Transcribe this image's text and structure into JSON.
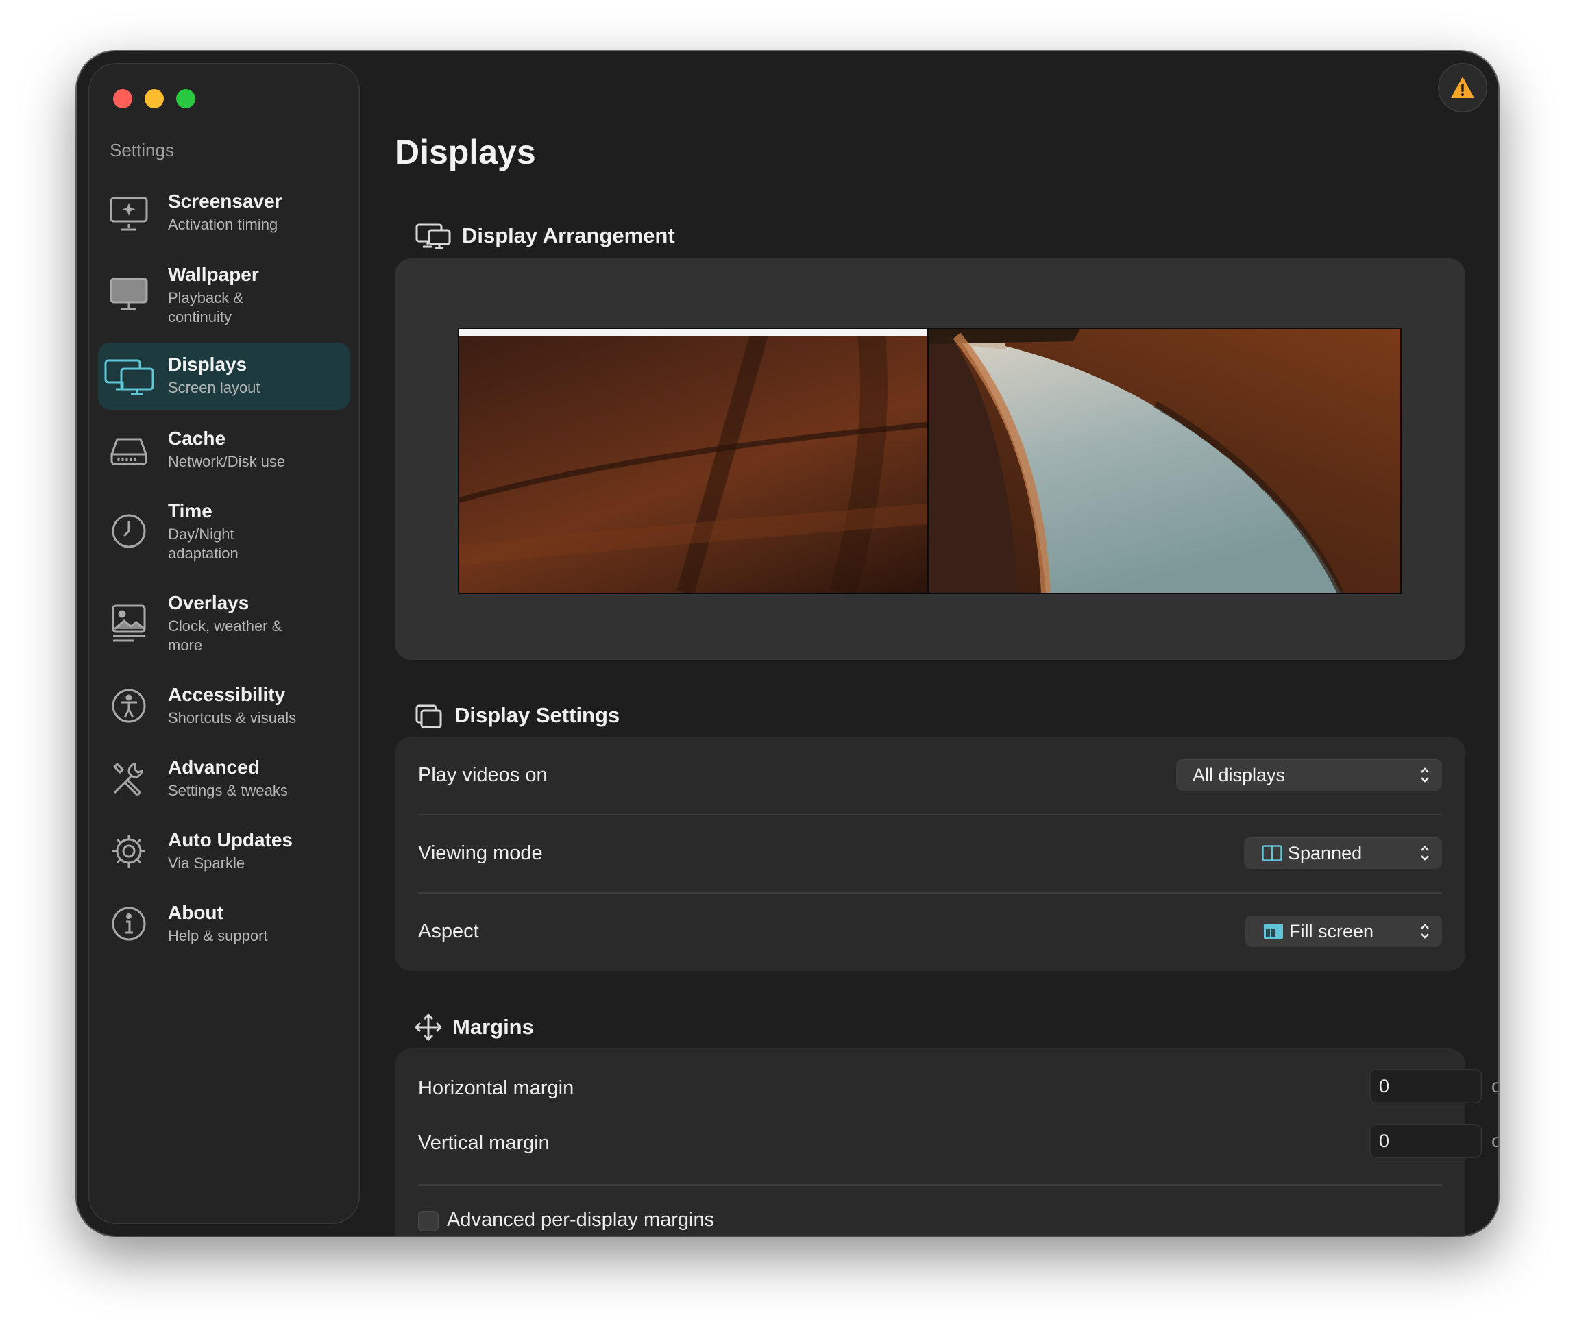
{
  "sidebar": {
    "heading": "Settings",
    "items": [
      {
        "title": "Screensaver",
        "subtitle": "Activation timing",
        "icon": "screensaver-icon"
      },
      {
        "title": "Wallpaper",
        "subtitle": "Playback & continuity",
        "icon": "monitor-icon"
      },
      {
        "title": "Displays",
        "subtitle": "Screen layout",
        "icon": "displays-icon",
        "active": true
      },
      {
        "title": "Cache",
        "subtitle": "Network/Disk use",
        "icon": "disk-icon"
      },
      {
        "title": "Time",
        "subtitle": "Day/Night adaptation",
        "icon": "clock-icon"
      },
      {
        "title": "Overlays",
        "subtitle": "Clock, weather & more",
        "icon": "photo-icon"
      },
      {
        "title": "Accessibility",
        "subtitle": "Shortcuts & visuals",
        "icon": "accessibility-icon"
      },
      {
        "title": "Advanced",
        "subtitle": "Settings & tweaks",
        "icon": "tools-icon"
      },
      {
        "title": "Auto Updates",
        "subtitle": "Via Sparkle",
        "icon": "gear-icon"
      },
      {
        "title": "About",
        "subtitle": "Help & support",
        "icon": "info-icon"
      }
    ]
  },
  "header": {
    "title": "Displays",
    "warning_icon": "warning-icon"
  },
  "arrangement": {
    "title": "Display Arrangement"
  },
  "display_settings": {
    "title": "Display Settings",
    "rows": [
      {
        "label": "Play videos on",
        "value": "All displays"
      },
      {
        "label": "Viewing mode",
        "value": "Spanned"
      },
      {
        "label": "Aspect",
        "value": "Fill screen"
      }
    ]
  },
  "margins": {
    "title": "Margins",
    "horizontal_label": "Horizontal margin",
    "horizontal_value": "0",
    "vertical_label": "Vertical margin",
    "vertical_value": "0",
    "unit": "cm",
    "advanced_label": "Advanced per-display margins"
  },
  "colors": {
    "accent": "#5ec6d6",
    "active_bg": "#1d3a3f",
    "warning": "#f5a623"
  }
}
